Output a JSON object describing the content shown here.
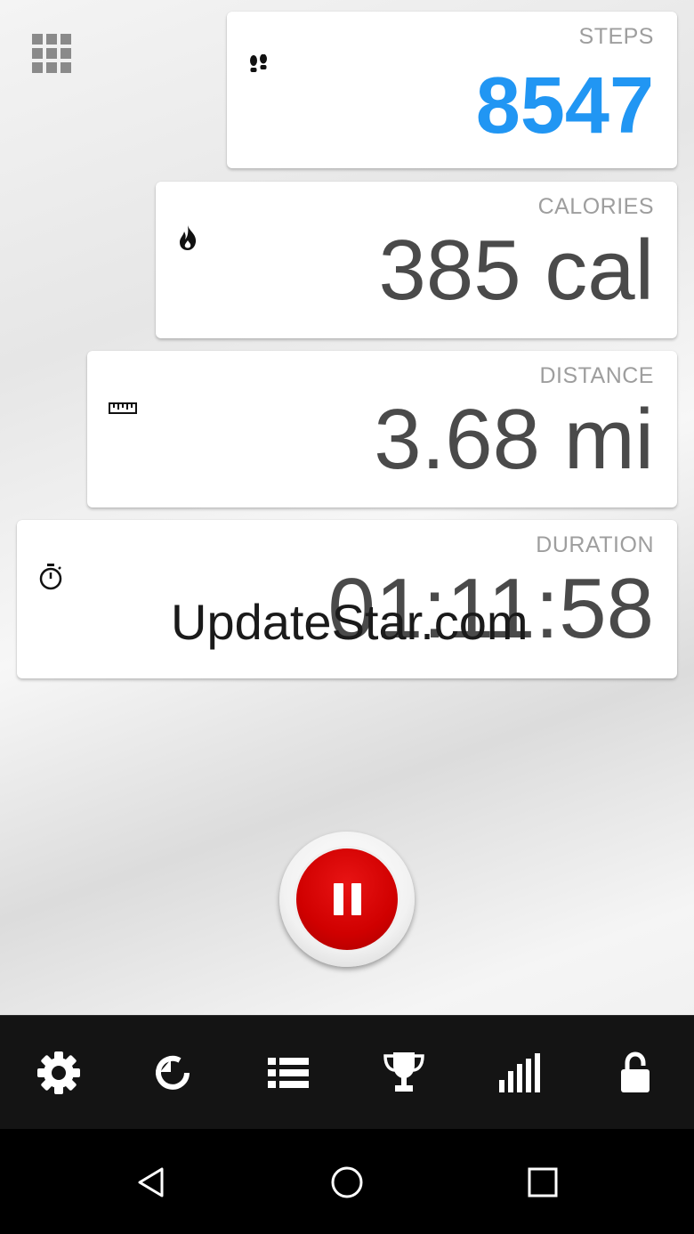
{
  "menu": {
    "icon": "grid-menu-icon"
  },
  "cards": {
    "steps": {
      "label": "STEPS",
      "value": "8547",
      "icon": "footsteps-icon",
      "color": "#2196f3"
    },
    "calories": {
      "label": "CALORIES",
      "value": "385 cal",
      "icon": "flame-icon"
    },
    "distance": {
      "label": "DISTANCE",
      "value": "3.68 mi",
      "icon": "ruler-icon"
    },
    "duration": {
      "label": "DURATION",
      "value": "01:11:58",
      "icon": "stopwatch-icon"
    }
  },
  "watermark": "UpdateStar.com",
  "pause_button": {
    "icon": "pause-icon",
    "color": "#d00000"
  },
  "toolbar": {
    "items": [
      "gear-icon",
      "refresh-icon",
      "list-icon",
      "trophy-icon",
      "bar-chart-icon",
      "lock-icon"
    ]
  },
  "navbar": {
    "items": [
      "back-triangle-icon",
      "home-circle-icon",
      "recents-square-icon"
    ]
  }
}
